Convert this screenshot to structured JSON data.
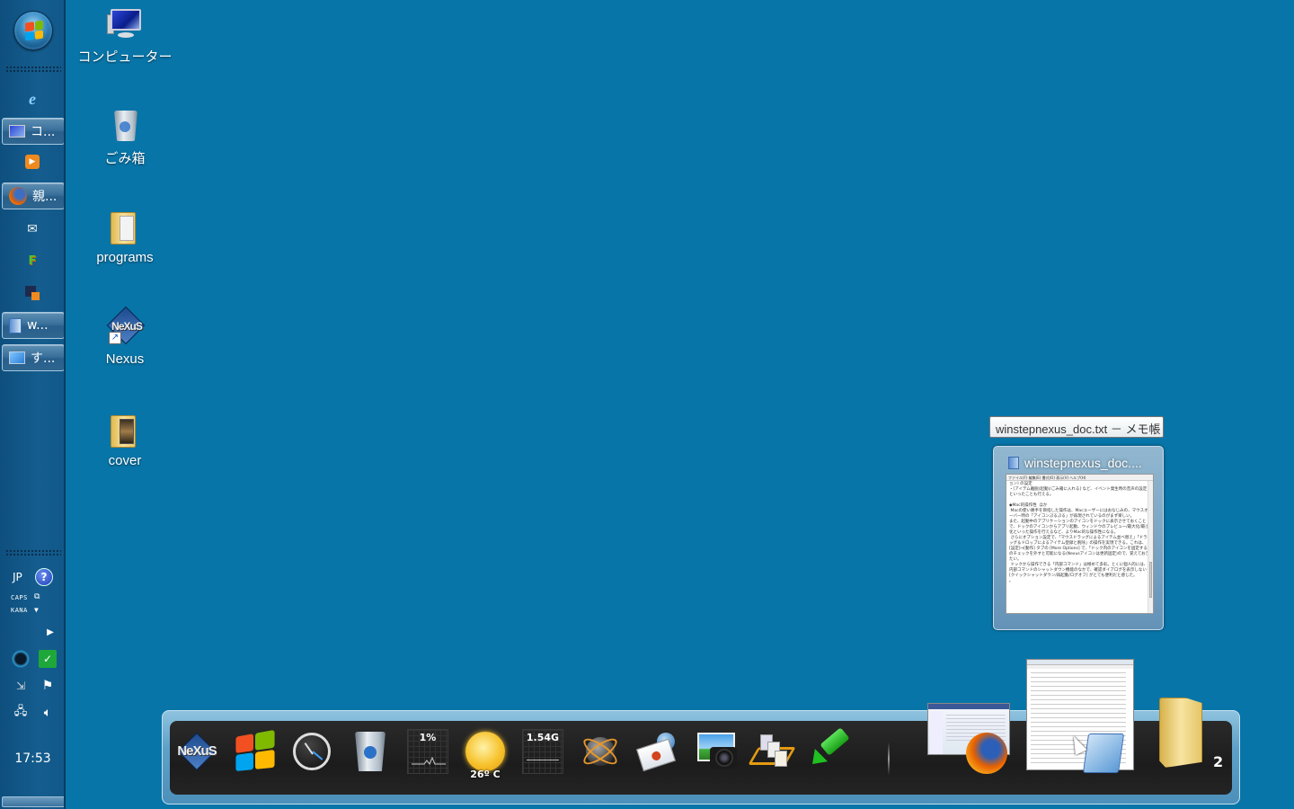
{
  "taskbar": {
    "start_button": "start-orb",
    "quick_launch": [
      {
        "name": "internet-explorer",
        "icon": "ie-icon",
        "glyph": "e"
      },
      {
        "name": "media-player",
        "icon": "media-player-icon",
        "glyph": "▶"
      },
      {
        "name": "mail",
        "icon": "mail-icon",
        "glyph": "✉"
      },
      {
        "name": "ffftp",
        "icon": "ftp-icon",
        "glyph": "F"
      },
      {
        "name": "app-squares",
        "icon": "squares-icon",
        "glyph": "■"
      }
    ],
    "tasks": [
      {
        "label": "コ...",
        "icon": "computer-icon"
      },
      {
        "label": "親...",
        "icon": "firefox-icon"
      },
      {
        "label": "w...",
        "icon": "notepad-icon"
      },
      {
        "label": "す...",
        "icon": "control-panel-icon"
      }
    ],
    "tray": {
      "language": "JP",
      "caps": "CAPS",
      "kana": "KANA",
      "clock": "17:53"
    }
  },
  "desktop": {
    "icons": [
      {
        "label": "コンピューター",
        "type": "computer"
      },
      {
        "label": "ごみ箱",
        "type": "recycle-bin"
      },
      {
        "label": "programs",
        "type": "folder"
      },
      {
        "label": "Nexus",
        "type": "shortcut"
      },
      {
        "label": "cover",
        "type": "folder"
      }
    ]
  },
  "tooltip": {
    "text": "winstepnexus_doc.txt － メモ帳"
  },
  "preview": {
    "title": "winstepnexus_doc....",
    "menu": "ファイル(F)  編集(E)  書式(O)  表示(V)  ヘルプ(H)",
    "body": "ョン) の設定\n・[アイテム離脱(起動)/ごみ箱に入れる] など、イベント発生時の音声の設定\nといったことも行える。\n\n◆Mac的操作性  ほか\n Macの使い勝手を目指した操作は、Macユーザーにはおなじみの、マウスオーバー時の「アイコンぷるぷる」が再現されているのがまず楽しい。\nまた、起動中のアプリケーションのアイコンをドックに表示させておくことで、ドックのアイコンからアプリ起動、ウィンドウのプレビュー/最大化/最小化といった操作を行えるなど、よりMac的な操作性になる。\n さらにオプション設定で、「マウスドラッグによるアイテム並べ替え」「ドラッグ＆ドロップによるアイテム登録と削除」の操作を実現できる。これは、[設定]→[動作] タブの [More Options] で、「ドック内のアイコンを固定する」のチェックを外すと可能になる(Nexusアイコンは更新固定)ので、覚えておきたい。\n ドックから操作できる「内部コマンド」は極めて多彩。とくに個人的には、内部コマンドのシャットダウン機能のなかで、確認ダイアログを表示しない [クイックシャットダウン/再起動/ログオフ] がとても便利だと感じた。\n。"
  },
  "dock": {
    "items": [
      {
        "name": "nexus",
        "icon": "nexus-icon",
        "label": "NeXuS"
      },
      {
        "name": "windows",
        "icon": "windows-icon"
      },
      {
        "name": "clock",
        "icon": "clock-icon"
      },
      {
        "name": "recycle-bin",
        "icon": "recycle-bin-icon"
      },
      {
        "name": "cpu-meter",
        "icon": "cpu-meter-icon",
        "value": "1%"
      },
      {
        "name": "weather",
        "icon": "weather-icon",
        "value": "26º C"
      },
      {
        "name": "memory-meter",
        "icon": "memory-meter-icon",
        "value": "1.54G"
      },
      {
        "name": "network",
        "icon": "network-globe-icon"
      },
      {
        "name": "email",
        "icon": "email-icon"
      },
      {
        "name": "photo",
        "icon": "camera-icon"
      },
      {
        "name": "file-copy",
        "icon": "file-copy-icon"
      },
      {
        "name": "usb",
        "icon": "usb-icon"
      }
    ],
    "running": [
      {
        "name": "firefox",
        "icon": "firefox-icon"
      },
      {
        "name": "notepad",
        "icon": "notepad-icon"
      },
      {
        "name": "explorer-folder",
        "icon": "folder-icon",
        "count": "2"
      }
    ]
  }
}
